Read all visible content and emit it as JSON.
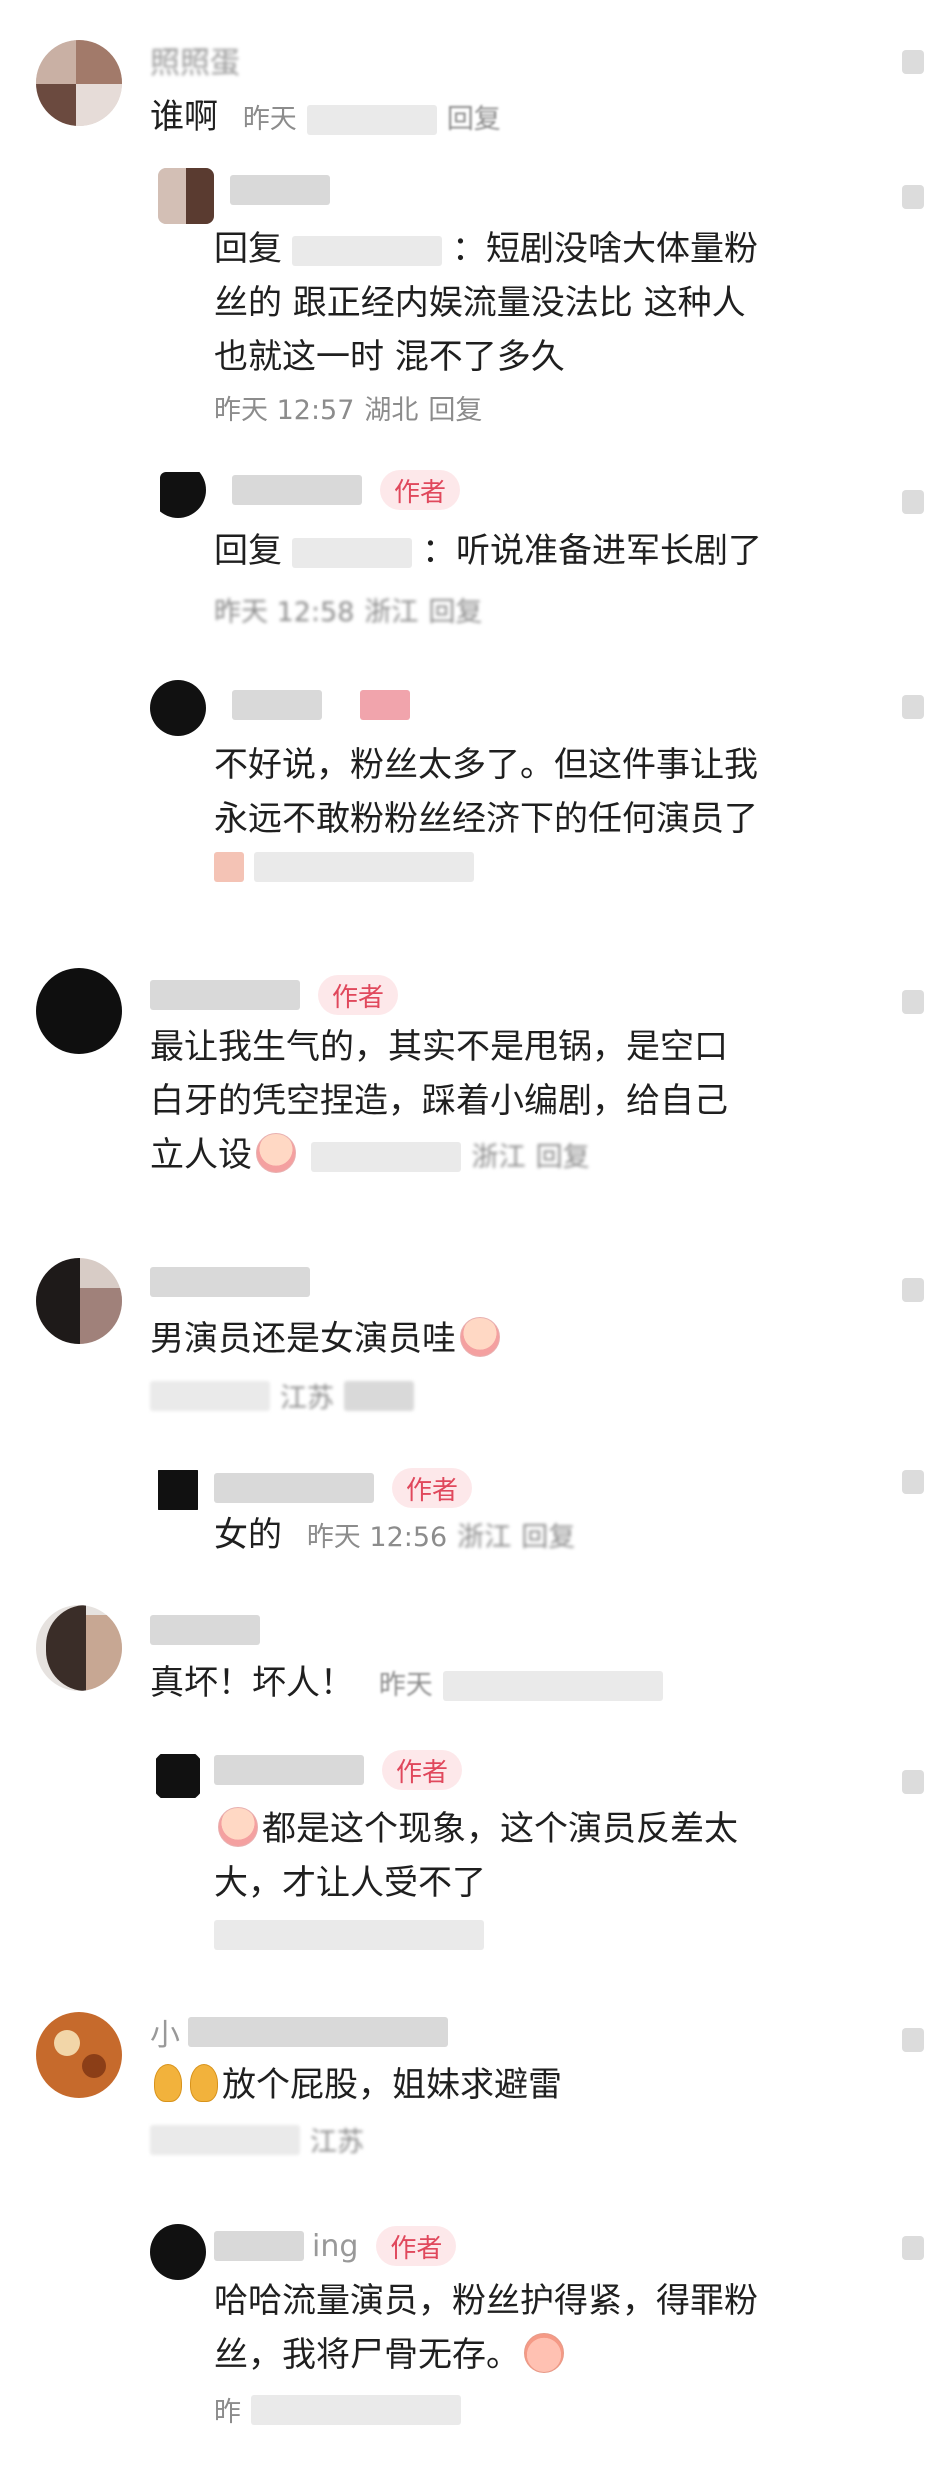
{
  "labels": {
    "author": "作者",
    "reply": "回复"
  },
  "comments": [
    {
      "name": "照照蛋",
      "text": "谁啊",
      "time": "昨天"
    },
    {
      "text": "回复 ：短剧没啥大体量粉丝的 跟正经内娱流量没法比 这种人也就这一时 混不了多久",
      "text_line1": "回复",
      "text_line1b": "：短剧没啥大体量粉",
      "text_line2": "丝的 跟正经内娱流量没法比 这种人",
      "text_line3": "也就这一时 混不了多久",
      "time": "昨天 12:57",
      "location": "湖北"
    },
    {
      "text_prefix": "回复",
      "text_suffix": "：听说准备进军长剧了",
      "time": "昨天 12:58",
      "location": "浙江"
    },
    {
      "text_line1": "不好说，粉丝太多了。但这件事让我",
      "text_line2": "永远不敢粉粉丝经济下的任何演员了"
    },
    {
      "text_line1": "最让我生气的，其实不是甩锅，是空口",
      "text_line2": "白牙的凭空捏造，踩着小编剧，给自己",
      "text_line3": "立人设",
      "location": "浙江"
    },
    {
      "text": "男演员还是女演员哇",
      "location": "江苏"
    },
    {
      "text": "女的",
      "time": "昨天 12:56",
      "location": "浙江"
    },
    {
      "text": "真坏！坏人！",
      "time": "昨天"
    },
    {
      "text_line1": "都是这个现象，这个演员反差太",
      "text_line2": "大，才让人受不了"
    },
    {
      "name_prefix": "小",
      "text": "放个屁股，姐妹求避雷",
      "location": "江苏"
    },
    {
      "name_suffix": "ing",
      "text_line1": "哈哈流量演员，粉丝护得紧，得罪粉",
      "text_line2": "丝，我将尸骨无存。",
      "time": "昨"
    }
  ]
}
